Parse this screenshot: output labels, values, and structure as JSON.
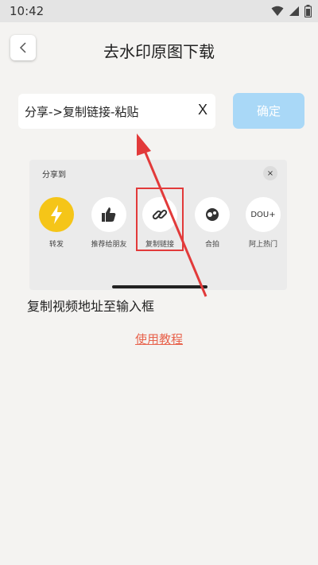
{
  "status_bar": {
    "time": "10:42",
    "icons": [
      "wifi-icon",
      "signal-icon",
      "battery-icon"
    ]
  },
  "header": {
    "title": "去水印原图下载",
    "back_icon": "chevron-left-icon"
  },
  "form": {
    "input_value": "分享->复制链接-粘贴",
    "clear_label": "X",
    "confirm_label": "确定"
  },
  "share_panel": {
    "title": "分享到",
    "close_label": "×",
    "items": [
      {
        "label": "转发",
        "icon": "lightning-icon"
      },
      {
        "label": "推荐给朋友",
        "icon": "thumb-up-icon"
      },
      {
        "label": "复制链接",
        "icon": "link-icon"
      },
      {
        "label": "合拍",
        "icon": "duet-icon"
      },
      {
        "label": "阿上热门",
        "icon": "dou-icon"
      }
    ],
    "dou_text": "DOU+"
  },
  "instructions": {
    "copy_tip": "复制视频地址至输入框",
    "tutorial_link": "使用教程"
  },
  "colors": {
    "background": "#f4f3f1",
    "confirm_button": "#a9d8f7",
    "highlight_red": "#e23a3a",
    "link_color": "#e8634d",
    "forward_yellow": "#f5c518"
  }
}
